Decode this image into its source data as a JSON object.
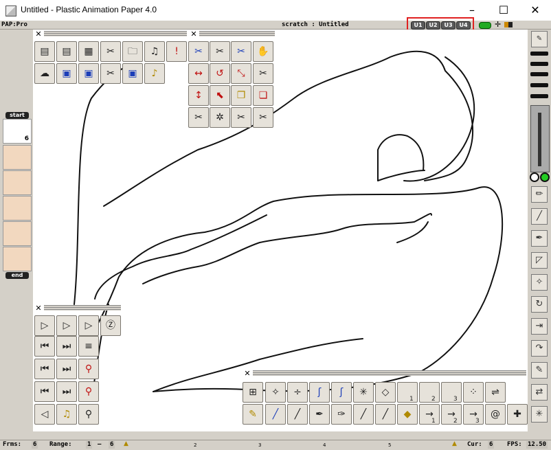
{
  "window": {
    "title": "Untitled - Plastic Animation Paper 4.0",
    "minimize_icon": "–",
    "maximize_icon": "☐",
    "close_icon": "✕"
  },
  "menubar": {
    "mode": "PAP:Pro",
    "scene": "scratch : Untitled",
    "user_buttons": [
      "U1",
      "U2",
      "U3",
      "U4"
    ]
  },
  "timeline": {
    "start_label": "start",
    "end_label": "end",
    "current_frame_number": "6"
  },
  "statusbar": {
    "frms_label": "Frms:",
    "frms_value": "6",
    "range_label": "Range:",
    "range_start": "1",
    "range_dash": "–",
    "range_end": "6",
    "ruler_ticks": [
      "2",
      "3",
      "4",
      "5"
    ],
    "cur_label": "Cur:",
    "cur_value": "6",
    "fps_label": "FPS:",
    "fps_value": "12.50"
  },
  "colors": {
    "accent_red_box": "#e02020",
    "frame_fill": "#f2d8bf",
    "canvas": "#ffffff"
  },
  "panels": {
    "file_panel": {
      "icons": [
        "load-scene-icon",
        "load-clip-icon",
        "paper-stack-icon",
        "cut-load-icon",
        "load-image-icon",
        "load-folder-icon",
        "alert-icon",
        "new-scene-icon",
        "save-icon",
        "save-as-icon",
        "cut-save-icon",
        "save-image-icon",
        "save-sound-icon"
      ]
    },
    "edit_panel": {
      "icons": [
        "cut-undo-icon",
        "cut-icon",
        "cut-blue-icon",
        "hand-icon",
        "flip-horizontal-icon",
        "rotate-icon",
        "scale-icon",
        "cut-paste-icon",
        "flip-vertical-icon",
        "move-icon",
        "copy-icon",
        "paste-icon",
        "scissors-icon",
        "sparkle-cut-icon",
        "cut-left-icon",
        "cut-small-icon"
      ]
    },
    "playback_panel": {
      "icons": [
        "play-loop-icon",
        "play-step-icon",
        "play-pen-icon",
        "zoom-z-icon",
        "prev-frame-icon",
        "next-frame-icon",
        "onion-levels-icon",
        "first-frame-icon",
        "last-frame-icon",
        "red-pin-icon",
        "first-marker-icon",
        "last-marker-icon",
        "red-pin-small-icon",
        "mirror-icon",
        "sound-icon",
        "gray-pin-icon"
      ]
    },
    "draw_panel": {
      "icons": [
        "add-frame-icon",
        "add-sparkle-icon",
        "divide-icon",
        "blue-draw-icon",
        "blue-draw2-icon",
        "sparkle-icon",
        "paper-icon",
        "bulb1-icon",
        "bulb2-icon",
        "bulb3-icon",
        "dots-plus-icon",
        "shift-icon",
        "pencil-erase-icon",
        "blue-lines-icon",
        "lines-icon",
        "feather-icon",
        "green-pen-icon",
        "diag-line-icon",
        "diag-line2-icon",
        "paper-brown-icon",
        "arrow1-icon",
        "arrow2-icon",
        "arrow3-icon",
        "spiral-icon",
        "cross-plus-icon"
      ],
      "number_labels": [
        "1",
        "2",
        "3",
        "1",
        "2",
        "3"
      ]
    }
  }
}
